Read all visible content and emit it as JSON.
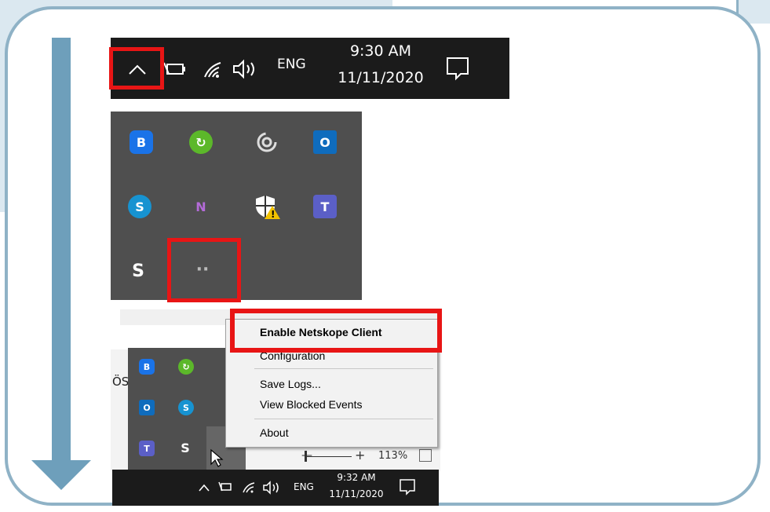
{
  "panel1": {
    "lang": "ENG",
    "time": "9:30 AM",
    "date": "11/11/2020"
  },
  "panel3": {
    "partial_text": "ÖS",
    "lang": "ENG",
    "time": "9:32 AM",
    "date": "11/11/2020",
    "zoom_minus": "—",
    "zoom_plus": "+",
    "zoom_level": "113%"
  },
  "context_menu": {
    "items": [
      {
        "label": "Enable Netskope Client",
        "bold": true
      },
      {
        "label": "Configuration",
        "bold": false
      },
      {
        "label": "Save Logs...",
        "bold": false
      },
      {
        "label": "View Blocked Events",
        "bold": false
      },
      {
        "label": "About",
        "bold": false
      }
    ]
  },
  "tray_icons": {
    "bluetooth": "B",
    "sync": "↻",
    "outlook": "O",
    "skype": "S",
    "onenote_clip": "N",
    "shield": "⛨",
    "teams": "T",
    "signal": "S",
    "netskope": "··"
  },
  "colors": {
    "accent_red": "#e81515",
    "frame_blue": "#8fb2c6",
    "arrow_blue": "#6e9fbb",
    "taskbar": "#1b1b1b",
    "tray": "#4f4f4f"
  }
}
